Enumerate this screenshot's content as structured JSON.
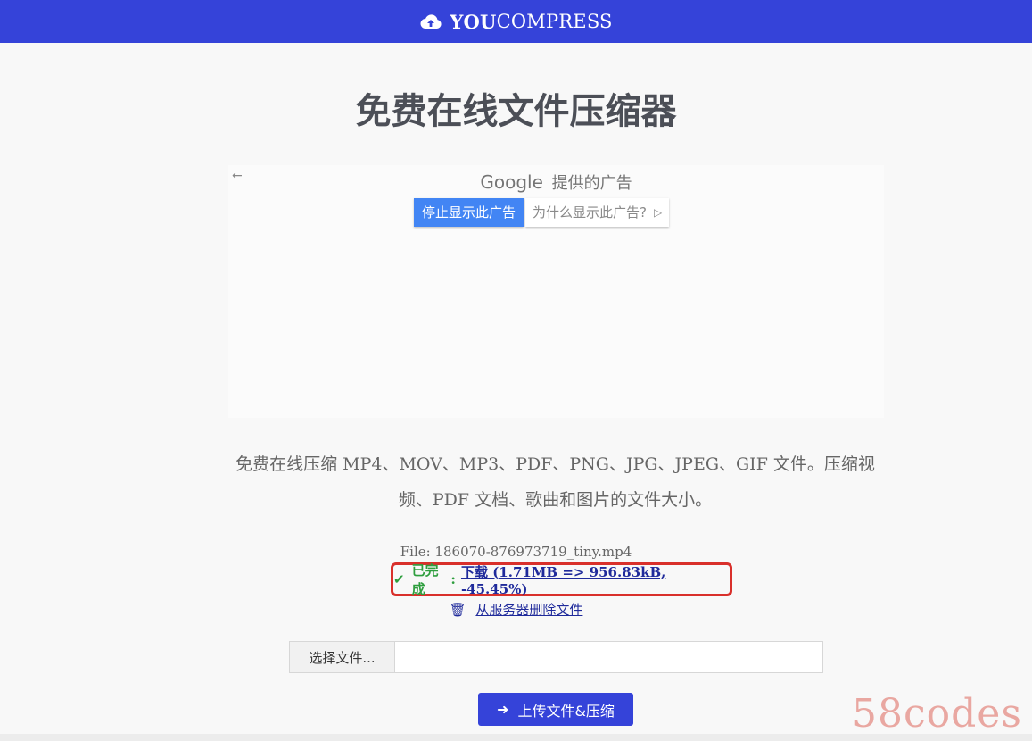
{
  "header": {
    "brand_bold": "YOU",
    "brand_light": "COMPRESS",
    "logo_icon": "cloud-upload-icon",
    "bg_color": "#3543d9"
  },
  "page": {
    "title": "免费在线文件压缩器"
  },
  "ad": {
    "provider_brand": "Google",
    "provider_text": "提供的广告",
    "stop_label": "停止显示此广告",
    "why_label": "为什么显示此广告?",
    "back_icon": "back-arrow-icon"
  },
  "description": "免费在线压缩 MP4、MOV、MP3、PDF、PNG、JPG、JPEG、GIF 文件。压缩视频、PDF 文档、歌曲和图片的文件大小。",
  "result": {
    "file_label": "File: 186070-876973719_tiny.mp4",
    "status_text": "已完成",
    "status_colon": ":",
    "download_label": "下载",
    "download_stats": " (1.71MB => 956.83kB, -45.45%)",
    "delete_label": "从服务器删除文件",
    "status_color": "#2e9e3e",
    "highlight_color": "#d9302b"
  },
  "upload": {
    "choose_label": "选择文件...",
    "upload_label": "上传文件&压缩"
  },
  "watermark": "58codes"
}
